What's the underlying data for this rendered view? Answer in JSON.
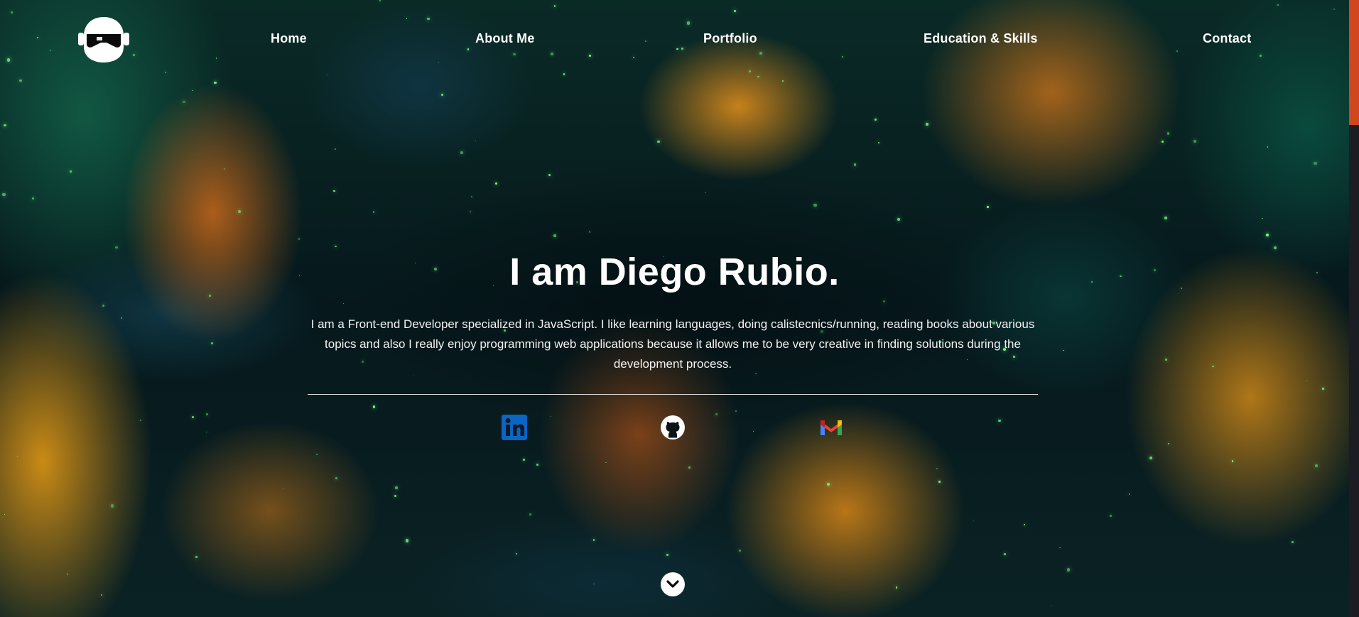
{
  "nav": {
    "items": [
      {
        "label": "Home"
      },
      {
        "label": "About Me"
      },
      {
        "label": "Portfolio"
      },
      {
        "label": "Education & Skills"
      },
      {
        "label": "Contact"
      }
    ]
  },
  "hero": {
    "title": "I am Diego Rubio.",
    "description": "I am a Front-end Developer specialized in JavaScript. I like learning languages, doing calistecnics/running, reading books about various topics and also I really enjoy programming web applications because it allows me to be very creative in finding solutions during the development process."
  },
  "social": [
    {
      "icon": "linkedin-icon",
      "color": "#0a66c2"
    },
    {
      "icon": "github-icon",
      "color": "#ffffff"
    },
    {
      "icon": "gmail-icon",
      "color": "#ea4335"
    }
  ],
  "colors": {
    "text": "#ffffff",
    "scroll_thumb": "#d2461d",
    "accent_orange": "#e8921a",
    "accent_teal": "#0f3a44"
  }
}
